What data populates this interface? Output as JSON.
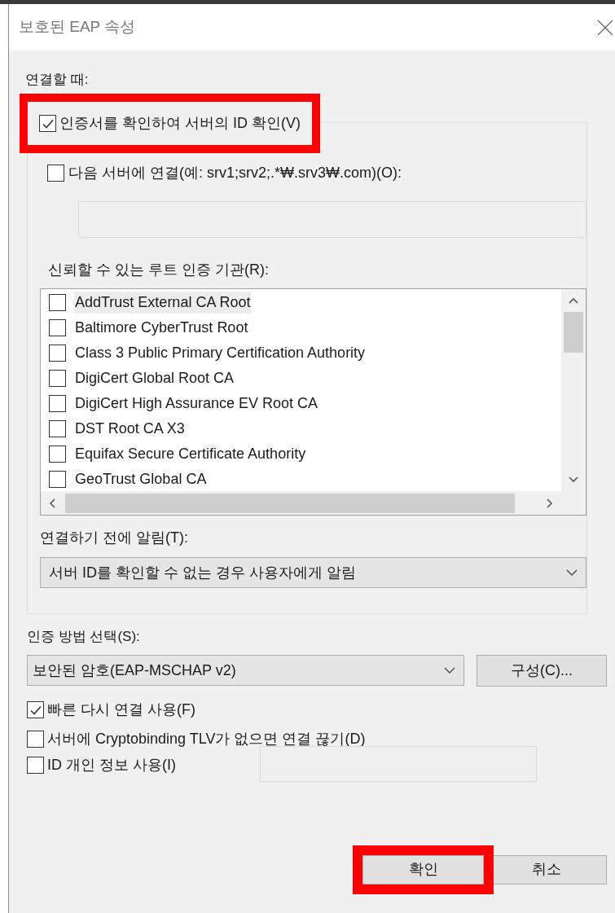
{
  "window": {
    "title": "보호된 EAP 속성"
  },
  "connect_section": {
    "label": "연결할 때:",
    "verify_certificate": {
      "label": "인증서를 확인하여 서버의 ID 확인(V)",
      "checked": true,
      "highlighted": true
    },
    "connect_servers": {
      "label": "다음 서버에 연결(예: srv1;srv2;.*₩.srv3₩.com)(O):",
      "checked": false
    },
    "trusted_roots": {
      "label": "신뢰할 수 있는 루트 인증 기관(R):",
      "items": [
        {
          "label": "AddTrust External CA Root",
          "checked": false,
          "selected": true
        },
        {
          "label": "Baltimore CyberTrust Root",
          "checked": false,
          "selected": false
        },
        {
          "label": "Class 3 Public Primary Certification Authority",
          "checked": false,
          "selected": false
        },
        {
          "label": "DigiCert Global Root CA",
          "checked": false,
          "selected": false
        },
        {
          "label": "DigiCert High Assurance EV Root CA",
          "checked": false,
          "selected": false
        },
        {
          "label": "DST Root CA X3",
          "checked": false,
          "selected": false
        },
        {
          "label": "Equifax Secure Certificate Authority",
          "checked": false,
          "selected": false
        },
        {
          "label": "GeoTrust Global CA",
          "checked": false,
          "selected": false
        }
      ]
    },
    "notify": {
      "label": "연결하기 전에 알림(T):",
      "value": "서버 ID를 확인할 수 없는 경우 사용자에게 알림"
    }
  },
  "auth_method": {
    "label": "인증 방법 선택(S):",
    "value": "보안된 암호(EAP-MSCHAP v2)",
    "configure_button": "구성(C)..."
  },
  "options": [
    {
      "kind": "checkbox",
      "label": "빠른 다시 연결 사용(F)",
      "checked": true
    },
    {
      "kind": "checkbox",
      "label": "서버에 Cryptobinding TLV가 없으면 연결 끊기(D)",
      "checked": false
    },
    {
      "kind": "checkbox-field",
      "label": "ID 개인 정보 사용(I)",
      "checked": false
    }
  ],
  "buttons": [
    {
      "label": "확인",
      "highlighted": true
    },
    {
      "label": "취소",
      "highlighted": false
    }
  ]
}
